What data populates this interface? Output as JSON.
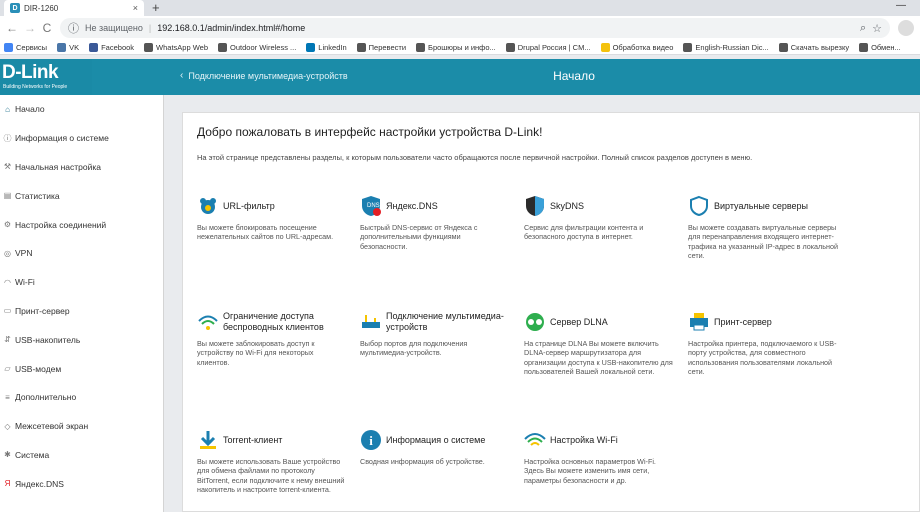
{
  "browser": {
    "tab_title": "DIR-1260",
    "tab_favicon": "D",
    "tab_close": "×",
    "new_tab": "+",
    "window_minimize": "—",
    "back": "←",
    "forward": "→",
    "reload": "C",
    "security_label": "Не защищено",
    "url": "192.168.0.1/admin/index.html#/home",
    "bookmarks": [
      {
        "label": "Сервисы",
        "color": "#4285f4"
      },
      {
        "label": "VK",
        "color": "#4a76a8"
      },
      {
        "label": "Facebook",
        "color": "#3b5998"
      },
      {
        "label": "WhatsApp Web",
        "color": "#555555"
      },
      {
        "label": "Outdoor Wireless ...",
        "color": "#555555"
      },
      {
        "label": "LinkedIn",
        "color": "#0077b5"
      },
      {
        "label": "Перевести",
        "color": "#555555"
      },
      {
        "label": "Брошюры и инфо...",
        "color": "#555555"
      },
      {
        "label": "Drupal Россия | CM...",
        "color": "#555555"
      },
      {
        "label": "Обработка видео",
        "color": "#f4c20d"
      },
      {
        "label": "English-Russian Dic...",
        "color": "#555555"
      },
      {
        "label": "Скачать вырезку",
        "color": "#555555"
      },
      {
        "label": "Обмен...",
        "color": "#555555"
      }
    ]
  },
  "header": {
    "logo": "D-Link",
    "logo_tagline": "Building Networks for People",
    "back_chevron": "‹",
    "back_label": "Подключение мультимедиа-устройств",
    "title": "Начало"
  },
  "sidebar": {
    "items": [
      {
        "icon": "home-icon",
        "glyph": "⌂",
        "label": "Начало",
        "active": true
      },
      {
        "icon": "info-icon",
        "glyph": "ⓘ",
        "label": "Информация о системе"
      },
      {
        "icon": "wrench-icon",
        "glyph": "⚒",
        "label": "Начальная настройка"
      },
      {
        "icon": "chart-icon",
        "glyph": "▤",
        "label": "Статистика"
      },
      {
        "icon": "connections-icon",
        "glyph": "⚙",
        "label": "Настройка соединений"
      },
      {
        "icon": "vpn-icon",
        "glyph": "◎",
        "label": "VPN"
      },
      {
        "icon": "wifi-icon",
        "glyph": "◠",
        "label": "Wi-Fi"
      },
      {
        "icon": "printer-icon",
        "glyph": "▭",
        "label": "Принт-сервер"
      },
      {
        "icon": "usb-icon",
        "glyph": "⇵",
        "label": "USB-накопитель"
      },
      {
        "icon": "modem-icon",
        "glyph": "▱",
        "label": "USB-модем"
      },
      {
        "icon": "more-icon",
        "glyph": "≡",
        "label": "Дополнительно"
      },
      {
        "icon": "shield-icon",
        "glyph": "◇",
        "label": "Межсетевой экран"
      },
      {
        "icon": "gear-icon",
        "glyph": "✱",
        "label": "Система"
      },
      {
        "icon": "yandex-icon",
        "glyph": "Я",
        "label": "Яндекс.DNS"
      }
    ]
  },
  "main": {
    "heading": "Добро пожаловать в интерфейс настройки устройства D-Link!",
    "intro": "На этой странице представлены разделы, к которым пользователи часто обращаются после первичной настройки. Полный список разделов доступен в меню.",
    "tiles": [
      {
        "title": "URL-фильтр",
        "desc": "Вы можете блокировать посещение нежелательных сайтов по URL-адресам.",
        "icon": "url-filter-icon"
      },
      {
        "title": "Яндекс.DNS",
        "desc": "Быстрый DNS-сервис от Яндекса с дополнительными функциями безопасности.",
        "icon": "yandex-dns-icon",
        "icon_text": "DNS"
      },
      {
        "title": "SkyDNS",
        "desc": "Сервис для фильтрации контента и безопасного доступа в интернет.",
        "icon": "skydns-icon"
      },
      {
        "title": "Виртуальные серверы",
        "desc": "Вы можете создавать виртуальные серверы для перенаправления входящего интернет-трафика на указанный IP-адрес в локальной сети.",
        "icon": "virtual-servers-icon"
      },
      {
        "title": "Ограничение доступа беспроводных клиентов",
        "desc": "Вы можете заблокировать доступ к устройству по Wi-Fi для некоторых клиентов.",
        "icon": "wifi-restrict-icon"
      },
      {
        "title": "Подключение мультимедиа-устройств",
        "desc": "Выбор портов для подключения мультимедиа-устройств.",
        "icon": "multimedia-icon"
      },
      {
        "title": "Сервер DLNA",
        "desc": "На странице DLNA Вы можете включить DLNA-сервер маршрутизатора для организации доступа к USB-накопителю для пользователей Вашей локальной сети.",
        "icon": "dlna-icon"
      },
      {
        "title": "Принт-сервер",
        "desc": "Настройка принтера, подключаемого к USB-порту устройства, для совместного использования пользователями локальной сети.",
        "icon": "print-server-icon"
      },
      {
        "title": "Torrent-клиент",
        "desc": "Вы можете использовать Ваше устройство для обмена файлами по протоколу BitTorrent, если подключите к нему внешний накопитель и настроите torrent-клиента.",
        "icon": "torrent-icon"
      },
      {
        "title": "Информация о системе",
        "desc": "Сводная информация об устройстве.",
        "icon": "system-info-icon",
        "icon_text": "i"
      },
      {
        "title": "Настройка Wi-Fi",
        "desc": "Настройка основных параметров Wi-Fi. Здесь Вы можете изменить имя сети, параметры безопасности и др.",
        "icon": "wifi-settings-icon"
      }
    ]
  },
  "colors": {
    "brand": "#1b8ca8",
    "icon_blue": "#1b7fb0",
    "icon_green": "#2eae4e",
    "icon_yellow": "#f5c400"
  }
}
